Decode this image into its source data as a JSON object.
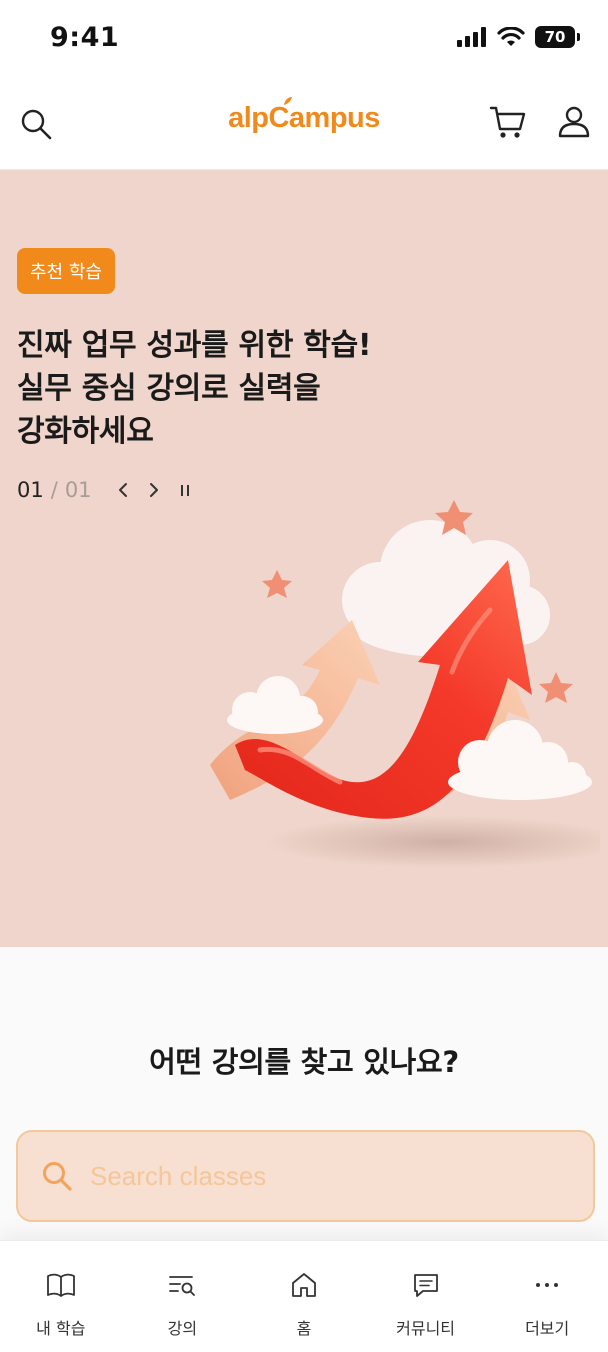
{
  "status_bar": {
    "time": "9:41",
    "battery": "70"
  },
  "header": {
    "logo": "alpCampus",
    "search_icon": "search-icon",
    "cart_icon": "cart-icon",
    "user_icon": "user-icon"
  },
  "hero": {
    "badge": "추천 학습",
    "title": "진짜 업무 성과를 위한 학습!\n실무 중심 강의로 실력을\n강화하세요",
    "pager": {
      "current": "01",
      "separator": "/",
      "total": "01"
    },
    "illustration": "rising-arrows-illustration"
  },
  "search": {
    "heading": "어떤 강의를 찾고 있나요?",
    "placeholder": "Search classes"
  },
  "bottom_nav": {
    "items": [
      {
        "label": "내 학습",
        "icon": "book-icon"
      },
      {
        "label": "강의",
        "icon": "course-list-icon"
      },
      {
        "label": "홈",
        "icon": "home-icon"
      },
      {
        "label": "커뮤니티",
        "icon": "chat-icon"
      },
      {
        "label": "더보기",
        "icon": "more-icon"
      }
    ]
  },
  "colors": {
    "brand": "#f08a1c",
    "hero_bg": "#efd5cb",
    "search_bg": "#f7e0d2",
    "search_border": "#f3c89b"
  }
}
